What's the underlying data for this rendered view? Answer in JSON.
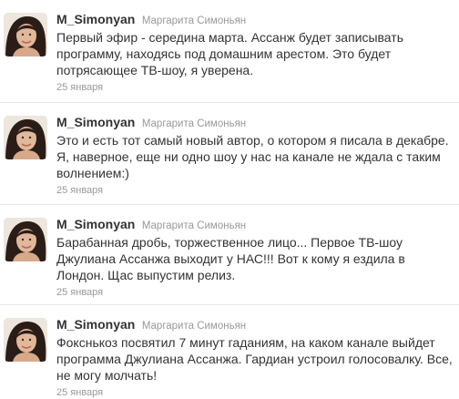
{
  "tweets": [
    {
      "screen_name": "M_Simonyan",
      "full_name": "Маргарита Симоньян",
      "text": "Первый эфир - середина марта. Ассанж будет записывать программу, находясь под домашним арестом. Это будет потрясающее ТВ-шоу, я уверена.",
      "time": "25 января"
    },
    {
      "screen_name": "M_Simonyan",
      "full_name": "Маргарита Симоньян",
      "text": "Это и есть тот самый новый автор, о котором я писала в декабре. Я, наверное, еще ни одно шоу у нас на канале не ждала с таким волнением:)",
      "time": "25 января"
    },
    {
      "screen_name": "M_Simonyan",
      "full_name": "Маргарита Симоньян",
      "text": "Барабанная дробь, торжественное лицо... Первое ТВ-шоу Джулиана Ассанжа выходит у НАС!!! Вот к кому я ездила в Лондон. Щас выпустим релиз.",
      "time": "25 января"
    },
    {
      "screen_name": "M_Simonyan",
      "full_name": "Маргарита Симоньян",
      "text": "Фокснькоз посвятил 7 минут гаданиям, на каком канале выйдет программа Джулиана Ассанжа. Гардиан устроил голосовалку. Все, не могу молчать!",
      "time": "25 января"
    }
  ],
  "colors": {
    "screen_name": "#333333",
    "full_name": "#999999",
    "text": "#333333",
    "time": "#999999",
    "divider": "#e8e8e8"
  }
}
